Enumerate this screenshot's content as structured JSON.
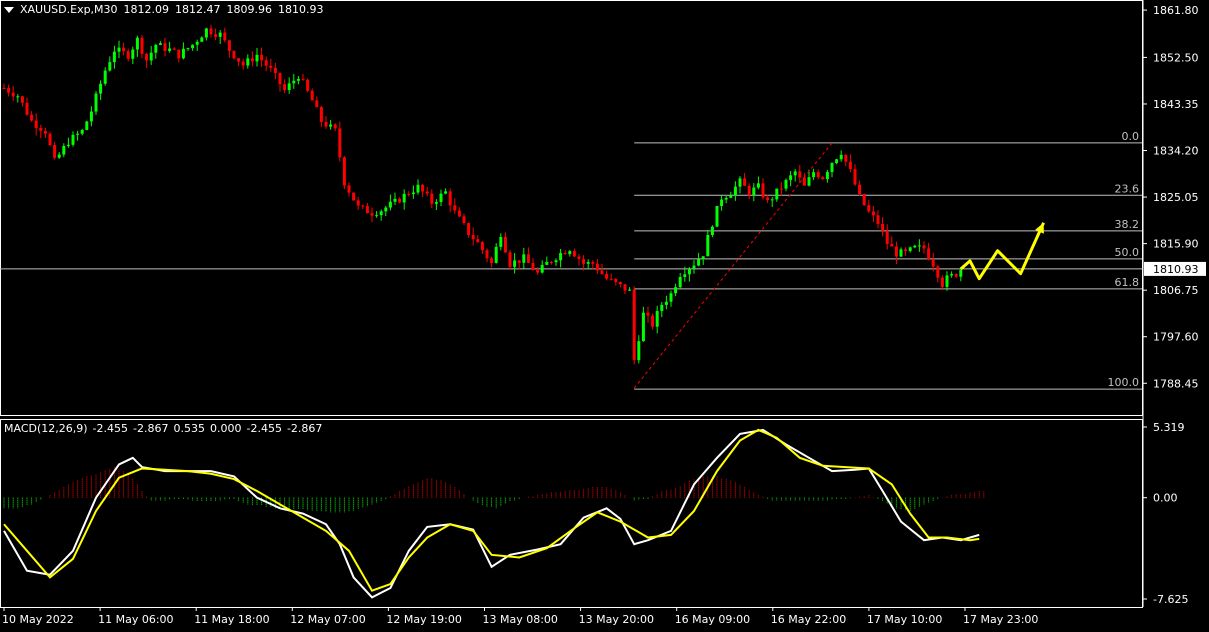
{
  "header": {
    "symbol": "XAUUSD.Exp,M30",
    "open": "1812.09",
    "high": "1812.47",
    "low": "1809.96",
    "close": "1810.93"
  },
  "macd_header": {
    "name": "MACD(12,26,9)",
    "v1": "-2.455",
    "v2": "-2.867",
    "v3": "0.535",
    "v4": "0.000",
    "v5": "-2.455",
    "v6": "-2.867"
  },
  "colors": {
    "background": "#000000",
    "bull_candle": "#00ff00",
    "bear_candle": "#ff0000",
    "fib_line": "#c0c0c0",
    "trend_line": "#ff0000",
    "macd_line": "#ffffff",
    "signal_line": "#ffff00",
    "hist_positive": "#ff0000",
    "hist_negative": "#00ff00",
    "projection_arrow": "#ffff00"
  },
  "chart_data": [
    {
      "type": "candlestick",
      "price_axis": {
        "min": 1783.0,
        "max": 1863.0,
        "ticks": [
          "1861.80",
          "1852.50",
          "1843.35",
          "1834.20",
          "1825.05",
          "1815.90",
          "1806.75",
          "1797.60",
          "1788.45"
        ]
      },
      "current_price": "1810.93",
      "time_axis": [
        "10 May 2022",
        "11 May 06:00",
        "11 May 18:00",
        "12 May 07:00",
        "12 May 19:00",
        "13 May 08:00",
        "13 May 20:00",
        "16 May 09:00",
        "16 May 22:00",
        "17 May 10:00",
        "17 May 23:00"
      ],
      "price_path": [
        [
          0,
          1846.5
        ],
        [
          3,
          1845
        ],
        [
          6,
          1840
        ],
        [
          9,
          1838
        ],
        [
          11,
          1832
        ],
        [
          14,
          1836
        ],
        [
          17,
          1838
        ],
        [
          19,
          1842
        ],
        [
          22,
          1850
        ],
        [
          24,
          1854
        ],
        [
          27,
          1853
        ],
        [
          29,
          1856
        ],
        [
          31,
          1852
        ],
        [
          33,
          1855
        ],
        [
          36,
          1854
        ],
        [
          38,
          1853
        ],
        [
          41,
          1855
        ],
        [
          44,
          1858
        ],
        [
          47,
          1857
        ],
        [
          49,
          1854
        ],
        [
          52,
          1851
        ],
        [
          55,
          1853
        ],
        [
          58,
          1850
        ],
        [
          61,
          1846
        ],
        [
          64,
          1849
        ],
        [
          67,
          1844
        ],
        [
          69,
          1840
        ],
        [
          72,
          1838
        ],
        [
          74,
          1828
        ],
        [
          77,
          1823
        ],
        [
          80,
          1822
        ],
        [
          82,
          1822.5
        ],
        [
          85,
          1824
        ],
        [
          88,
          1826
        ],
        [
          90,
          1827
        ],
        [
          93,
          1824
        ],
        [
          96,
          1826
        ],
        [
          98,
          1822
        ],
        [
          101,
          1818
        ],
        [
          103,
          1816
        ],
        [
          106,
          1812
        ],
        [
          108,
          1818
        ],
        [
          110,
          1812
        ],
        [
          113,
          1813
        ],
        [
          116,
          1810
        ],
        [
          118,
          1812
        ],
        [
          121,
          1814
        ],
        [
          123,
          1815
        ],
        [
          126,
          1812
        ],
        [
          128,
          1812
        ],
        [
          131,
          1809
        ],
        [
          133,
          1808
        ],
        [
          136,
          1806.5
        ],
        [
          137,
          1793
        ],
        [
          139,
          1802
        ],
        [
          141,
          1800
        ],
        [
          143,
          1804
        ],
        [
          145,
          1806
        ],
        [
          147,
          1810
        ],
        [
          150,
          1812
        ],
        [
          152,
          1814
        ],
        [
          154,
          1820
        ],
        [
          156,
          1825
        ],
        [
          158,
          1826
        ],
        [
          160,
          1828
        ],
        [
          162,
          1826
        ],
        [
          164,
          1827
        ],
        [
          166,
          1824
        ],
        [
          168,
          1826
        ],
        [
          170,
          1828
        ],
        [
          172,
          1830
        ],
        [
          174,
          1827
        ],
        [
          176,
          1830
        ],
        [
          178,
          1829
        ],
        [
          180,
          1832
        ],
        [
          182,
          1834
        ],
        [
          184,
          1830
        ],
        [
          186,
          1825
        ],
        [
          188,
          1822
        ],
        [
          190,
          1820
        ],
        [
          192,
          1816
        ],
        [
          194,
          1814
        ],
        [
          196,
          1814
        ],
        [
          198,
          1815
        ],
        [
          200,
          1815
        ],
        [
          202,
          1812
        ],
        [
          204,
          1808
        ],
        [
          205,
          1809
        ],
        [
          207,
          1810
        ],
        [
          208,
          1810.9
        ]
      ],
      "fibonacci_levels": [
        {
          "label": "0.0",
          "price": 1835.7
        },
        {
          "label": "23.6",
          "price": 1825.4
        },
        {
          "label": "38.2",
          "price": 1818.4
        },
        {
          "label": "50.0",
          "price": 1812.9
        },
        {
          "label": "61.8",
          "price": 1807.0
        },
        {
          "label": "100.0",
          "price": 1787.3
        }
      ],
      "trend_line": {
        "from": [
          137,
          1787.5
        ],
        "to": [
          180,
          1835.7
        ]
      },
      "projection_arrow": [
        [
          208,
          1810.9
        ],
        [
          210,
          1812.5
        ],
        [
          212,
          1809
        ],
        [
          216,
          1814.5
        ],
        [
          221,
          1810
        ],
        [
          226,
          1820
        ]
      ]
    },
    {
      "type": "macd",
      "name": "MACD(12,26,9)",
      "axis": {
        "min": -7.625,
        "max": 5.319,
        "ticks": [
          "5.319",
          "0.00",
          "-7.625"
        ]
      },
      "macd": [
        [
          0,
          -2.5
        ],
        [
          5,
          -5.5
        ],
        [
          10,
          -5.8
        ],
        [
          15,
          -4.0
        ],
        [
          20,
          0.0
        ],
        [
          25,
          2.5
        ],
        [
          28,
          3.0
        ],
        [
          30,
          2.3
        ],
        [
          35,
          2.0
        ],
        [
          40,
          2.0
        ],
        [
          45,
          2.0
        ],
        [
          50,
          1.6
        ],
        [
          55,
          0.0
        ],
        [
          60,
          -0.8
        ],
        [
          65,
          -1.2
        ],
        [
          70,
          -2.0
        ],
        [
          73,
          -3.5
        ],
        [
          76,
          -6.0
        ],
        [
          80,
          -7.5
        ],
        [
          84,
          -6.8
        ],
        [
          88,
          -4.0
        ],
        [
          92,
          -2.2
        ],
        [
          97,
          -2.0
        ],
        [
          102,
          -2.4
        ],
        [
          106,
          -5.2
        ],
        [
          110,
          -4.3
        ],
        [
          116,
          -3.9
        ],
        [
          121,
          -3.5
        ],
        [
          126,
          -1.5
        ],
        [
          131,
          -0.8
        ],
        [
          134,
          -1.6
        ],
        [
          137,
          -3.5
        ],
        [
          140,
          -3.2
        ],
        [
          145,
          -2.5
        ],
        [
          150,
          1.0
        ],
        [
          155,
          3.0
        ],
        [
          160,
          4.8
        ],
        [
          165,
          5.1
        ],
        [
          170,
          4.0
        ],
        [
          175,
          3.0
        ],
        [
          180,
          2.0
        ],
        [
          185,
          2.1
        ],
        [
          188,
          2.2
        ],
        [
          191,
          0.5
        ],
        [
          195,
          -1.8
        ],
        [
          200,
          -3.2
        ],
        [
          204,
          -3.0
        ],
        [
          208,
          -3.2
        ],
        [
          212,
          -2.8
        ]
      ],
      "signal": [
        [
          0,
          -2.0
        ],
        [
          5,
          -4.0
        ],
        [
          10,
          -6.0
        ],
        [
          15,
          -4.6
        ],
        [
          20,
          -1.0
        ],
        [
          25,
          1.5
        ],
        [
          30,
          2.2
        ],
        [
          35,
          2.1
        ],
        [
          40,
          2.0
        ],
        [
          45,
          1.8
        ],
        [
          50,
          1.4
        ],
        [
          55,
          0.5
        ],
        [
          60,
          -0.5
        ],
        [
          65,
          -1.5
        ],
        [
          70,
          -2.5
        ],
        [
          75,
          -4.0
        ],
        [
          80,
          -7.0
        ],
        [
          84,
          -6.5
        ],
        [
          88,
          -4.5
        ],
        [
          92,
          -3.0
        ],
        [
          97,
          -2.0
        ],
        [
          102,
          -2.5
        ],
        [
          106,
          -4.3
        ],
        [
          112,
          -4.5
        ],
        [
          118,
          -3.8
        ],
        [
          124,
          -2.3
        ],
        [
          129,
          -1.1
        ],
        [
          134,
          -1.8
        ],
        [
          140,
          -3.0
        ],
        [
          145,
          -2.8
        ],
        [
          150,
          -1.0
        ],
        [
          155,
          2.0
        ],
        [
          160,
          4.3
        ],
        [
          164,
          5.1
        ],
        [
          168,
          4.5
        ],
        [
          173,
          3.0
        ],
        [
          178,
          2.4
        ],
        [
          183,
          2.3
        ],
        [
          188,
          2.2
        ],
        [
          193,
          1.0
        ],
        [
          197,
          -1.2
        ],
        [
          201,
          -3.0
        ],
        [
          205,
          -3.0
        ],
        [
          210,
          -3.2
        ],
        [
          212,
          -3.1
        ]
      ],
      "histogram": [
        [
          0,
          -0.8
        ],
        [
          3,
          -0.8
        ],
        [
          6,
          -0.5
        ],
        [
          9,
          0.0
        ],
        [
          12,
          0.6
        ],
        [
          15,
          1.2
        ],
        [
          18,
          1.6
        ],
        [
          21,
          1.9
        ],
        [
          24,
          2.3
        ],
        [
          26,
          2.0
        ],
        [
          28,
          1.5
        ],
        [
          30,
          0.5
        ],
        [
          32,
          -0.2
        ],
        [
          35,
          -0.2
        ],
        [
          38,
          -0.1
        ],
        [
          41,
          -0.2
        ],
        [
          44,
          -0.3
        ],
        [
          47,
          -0.2
        ],
        [
          50,
          -0.1
        ],
        [
          53,
          -0.5
        ],
        [
          56,
          -0.6
        ],
        [
          59,
          -0.8
        ],
        [
          62,
          -0.9
        ],
        [
          65,
          -0.9
        ],
        [
          68,
          -1.0
        ],
        [
          71,
          -1.1
        ],
        [
          74,
          -1.1
        ],
        [
          77,
          -0.9
        ],
        [
          80,
          -0.5
        ],
        [
          83,
          -0.1
        ],
        [
          86,
          0.5
        ],
        [
          89,
          1.0
        ],
        [
          92,
          1.5
        ],
        [
          95,
          1.3
        ],
        [
          98,
          0.8
        ],
        [
          101,
          0.0
        ],
        [
          104,
          -0.6
        ],
        [
          107,
          -0.8
        ],
        [
          110,
          -0.3
        ],
        [
          113,
          0.0
        ],
        [
          116,
          0.2
        ],
        [
          119,
          0.4
        ],
        [
          122,
          0.5
        ],
        [
          125,
          0.6
        ],
        [
          128,
          0.8
        ],
        [
          131,
          0.8
        ],
        [
          134,
          0.4
        ],
        [
          137,
          -0.2
        ],
        [
          140,
          -0.1
        ],
        [
          143,
          0.5
        ],
        [
          146,
          0.7
        ],
        [
          149,
          1.3
        ],
        [
          152,
          1.6
        ],
        [
          155,
          1.6
        ],
        [
          158,
          1.3
        ],
        [
          161,
          0.8
        ],
        [
          164,
          0.2
        ],
        [
          167,
          -0.2
        ],
        [
          170,
          -0.2
        ],
        [
          173,
          -0.2
        ],
        [
          176,
          -0.2
        ],
        [
          179,
          -0.2
        ],
        [
          182,
          -0.1
        ],
        [
          185,
          0.0
        ],
        [
          188,
          0.2
        ],
        [
          191,
          -0.3
        ],
        [
          194,
          -0.8
        ],
        [
          197,
          -1.0
        ],
        [
          200,
          -0.5
        ],
        [
          203,
          -0.1
        ],
        [
          206,
          0.2
        ],
        [
          209,
          0.3
        ],
        [
          212,
          0.5
        ]
      ]
    }
  ]
}
